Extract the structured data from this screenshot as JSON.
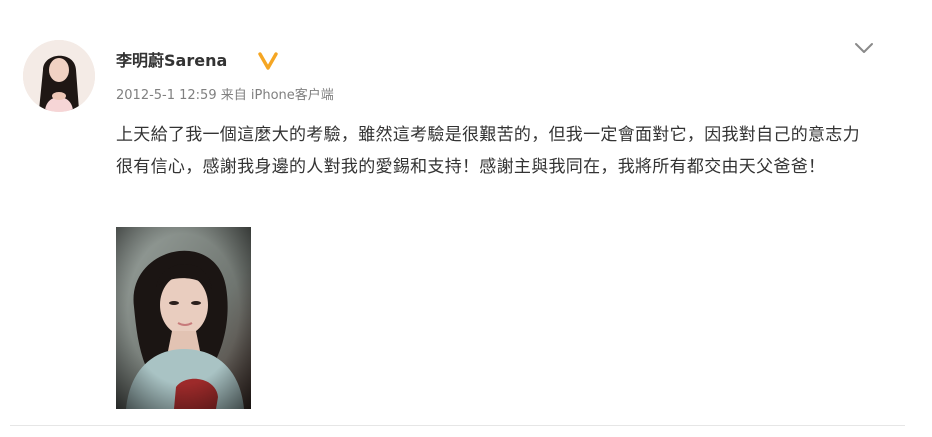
{
  "post": {
    "username": "李明蔚Sarena",
    "timestamp": "2012-5-1 12:59",
    "from_label": "来自",
    "source": "iPhone客户端",
    "text": "上天給了我一個這麼大的考驗，雖然這考驗是很艱苦的，但我一定會面對它，因我對自己的意志力很有信心，感謝我身邊的人對我的愛錫和支持！感謝主與我同在，我將所有都交由天父爸爸！"
  },
  "icons": {
    "verified": "verified-badge-icon",
    "menu": "chevron-down-icon"
  },
  "colors": {
    "text": "#333333",
    "meta": "#808080",
    "verified": "#f5a623",
    "chevron": "#8a8a8a"
  }
}
